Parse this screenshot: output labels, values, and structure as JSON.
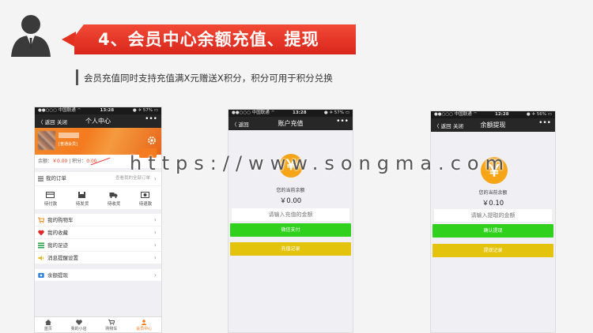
{
  "header": {
    "title": "4、会员中心余额充值、提现",
    "subtitle": "会员充值同时支持充值满X元赠送X积分，积分可用于积分兑换"
  },
  "watermark": "https://www.songma.com",
  "colors": {
    "banner": "#e2321f",
    "orange": "#f47b1f",
    "green": "#2fd11d",
    "yellow": "#e3c30b",
    "coin": "#f5a516"
  },
  "phone1": {
    "status": {
      "carrier": "●●○○○ 中国联通 ⌔",
      "time": "13:28",
      "battery": "● ✈ 57% ▭"
    },
    "nav": {
      "back": "〈 返回",
      "close": "关闭",
      "title": "个人中心",
      "more": "•••"
    },
    "user": {
      "level": "[普通会员]"
    },
    "balance": {
      "label": "余额：",
      "value": "￥0.00",
      "sep": "| 积分：",
      "points": "0.00"
    },
    "order": {
      "title": "我的订单",
      "hint": "查看我的全部订单"
    },
    "order_icons": [
      {
        "label": "待付款",
        "icon": "wallet-icon"
      },
      {
        "label": "待发货",
        "icon": "package-icon"
      },
      {
        "label": "待收货",
        "icon": "truck-icon"
      },
      {
        "label": "待退款",
        "icon": "refund-icon"
      }
    ],
    "menu1": [
      {
        "label": "我的购物车",
        "icon": "cart-icon"
      },
      {
        "label": "我的收藏",
        "icon": "heart-icon"
      },
      {
        "label": "我的足迹",
        "icon": "list-icon"
      },
      {
        "label": "消息提醒设置",
        "icon": "speaker-icon"
      }
    ],
    "menu2": [
      {
        "label": "余额提现",
        "icon": "withdraw-icon"
      }
    ],
    "tabs": [
      {
        "label": "首页",
        "icon": "home-icon"
      },
      {
        "label": "我的小店",
        "icon": "heart-shop-icon"
      },
      {
        "label": "购物车",
        "icon": "cart-tab-icon"
      },
      {
        "label": "会员中心",
        "icon": "user-icon"
      }
    ]
  },
  "phone2": {
    "status": {
      "carrier": "●●○○○ 中国联通 ⌔",
      "time": "13:28",
      "battery": "● ✈ 57% ▭"
    },
    "nav": {
      "back": "〈 返回",
      "title": "账户充值",
      "more": "•••"
    },
    "coin": "￥",
    "balance_label": "您的当前余额",
    "balance_value": "￥0.00",
    "input_placeholder": "请输入充值的金额",
    "primary_button": "微信支付",
    "secondary_button": "充值记录"
  },
  "phone3": {
    "status": {
      "carrier": "●●○○○ 中国联通 ⌔",
      "time": "12:28",
      "battery": "● ✈ 56% ▭"
    },
    "nav": {
      "back": "〈 返回",
      "close": "关闭",
      "title": "余额提现",
      "more": "•••"
    },
    "coin": "￥",
    "balance_label": "您的当前余额",
    "balance_value": "￥0.10",
    "input_placeholder": "请输入提取的金额",
    "primary_button": "确认提现",
    "secondary_button": "提现记录"
  }
}
